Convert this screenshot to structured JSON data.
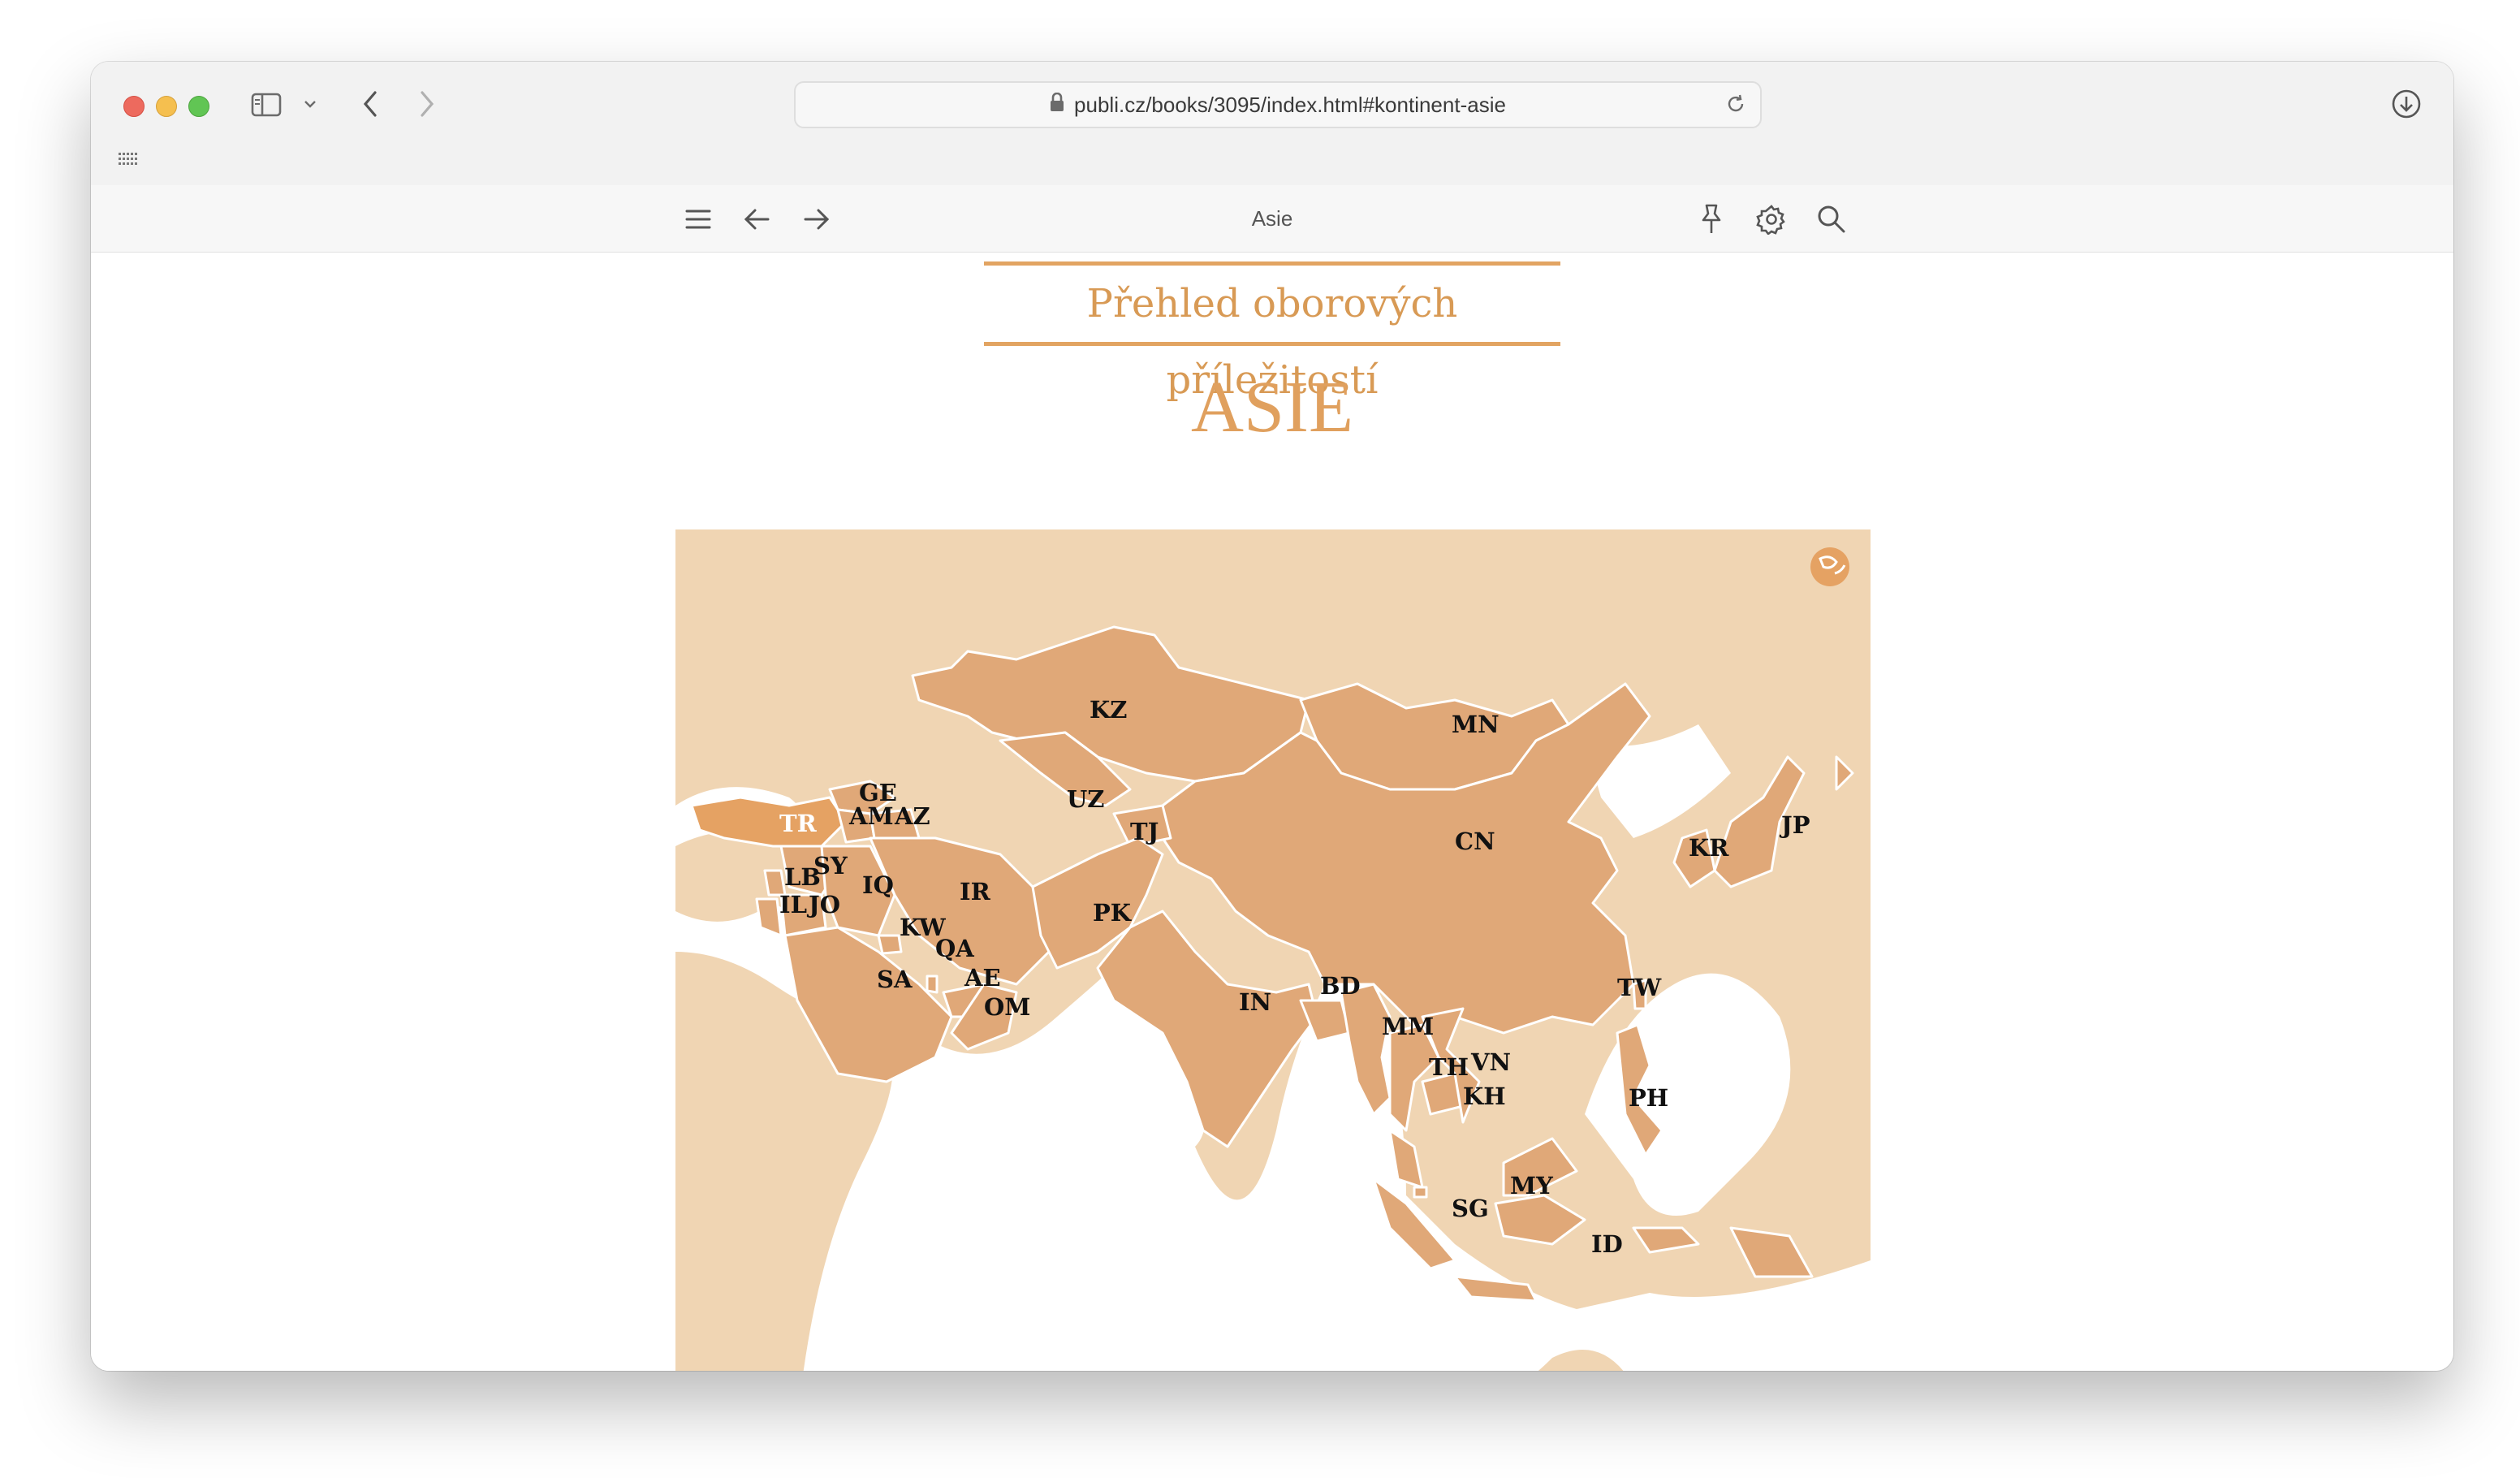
{
  "browser": {
    "url": "publi.cz/books/3095/index.html#kontinent-asie",
    "icons": {
      "sidebar": "sidebar-icon",
      "back": "chevron-left-icon",
      "forward": "chevron-right-icon",
      "lock": "lock-icon",
      "reload": "reload-icon",
      "downloads": "download-icon",
      "favorites": "grid-icon"
    }
  },
  "reader": {
    "title": "Asie",
    "icons": [
      "menu-icon",
      "arrow-left-icon",
      "arrow-right-icon",
      "pin-icon",
      "gear-icon",
      "search-icon"
    ]
  },
  "page": {
    "subtitle": "Přehled oborových příležitostí",
    "heading": "ASIE"
  },
  "map": {
    "colors": {
      "background_land": "#f0d5b3",
      "highlighted": "#e0a878",
      "selected": "#e5a263",
      "sea": "#ffffff",
      "border": "#ffffff"
    },
    "selected_country": "TR",
    "countries": [
      "KZ",
      "MN",
      "GE",
      "AM",
      "AZ",
      "UZ",
      "TJ",
      "TR",
      "CN",
      "KR",
      "JP",
      "LB",
      "SY",
      "IQ",
      "IR",
      "IL",
      "JO",
      "PK",
      "KW",
      "QA",
      "AE",
      "SA",
      "OM",
      "IN",
      "BD",
      "TW",
      "MM",
      "VN",
      "TH",
      "KH",
      "PH",
      "MY",
      "SG",
      "ID"
    ]
  }
}
